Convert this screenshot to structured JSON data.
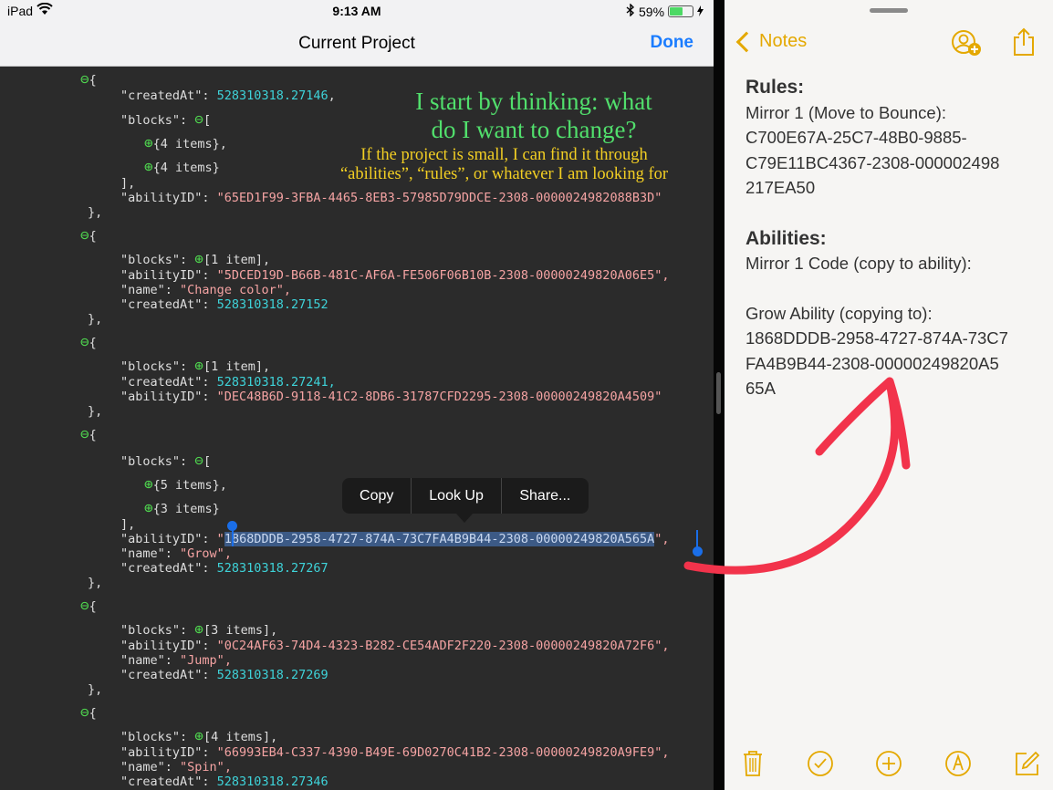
{
  "status": {
    "carrier": "iPad",
    "time": "9:13 AM",
    "battery": "59%",
    "battery_fraction": 0.59
  },
  "nav": {
    "title": "Current Project",
    "done_label": "Done"
  },
  "code": {
    "l1_created_key": "\"createdAt\"",
    "l1_created_val": "528310318.27146",
    "l1_blocks_key": "\"blocks\"",
    "l1_items_a": "{4 items},",
    "l1_items_b": "{4 items}",
    "l1_ability_key": "\"abilityID\"",
    "l1_ability_val": "\"65ED1F99-3FBA-4465-8EB3-57985D79DDCE-2308-0000024982088B3D\"",
    "l2_blocks_key": "\"blocks\"",
    "l2_items": "[1 item],",
    "l2_ability_key": "\"abilityID\"",
    "l2_ability_val": "\"5DCED19D-B66B-481C-AF6A-FE506F06B10B-2308-00000249820A06E5\",",
    "l2_name_key": "\"name\"",
    "l2_name_val": "\"Change color\",",
    "l2_created_key": "\"createdAt\"",
    "l2_created_val": "528310318.27152",
    "l3_blocks_key": "\"blocks\"",
    "l3_items": "[1 item],",
    "l3_created_key": "\"createdAt\"",
    "l3_created_val": "528310318.27241,",
    "l3_ability_key": "\"abilityID\"",
    "l3_ability_val": "\"DEC48B6D-9118-41C2-8DB6-31787CFD2295-2308-00000249820A4509\"",
    "l4_blocks_key": "\"blocks\"",
    "l4_items_a": "{5 items},",
    "l4_items_b": "{3 items}",
    "l4_ability_key": "\"abilityID\"",
    "l4_ability_sel": "1868DDDB-2958-4727-874A-73C7FA4B9B44-2308-00000249820A565A",
    "l4_name_key": "\"name\"",
    "l4_name_val": "\"Grow\",",
    "l4_created_key": "\"createdAt\"",
    "l4_created_val": "528310318.27267",
    "l5_blocks_key": "\"blocks\"",
    "l5_items": "[3 items],",
    "l5_ability_key": "\"abilityID\"",
    "l5_ability_val": "\"0C24AF63-74D4-4323-B282-CE54ADF2F220-2308-00000249820A72F6\",",
    "l5_name_key": "\"name\"",
    "l5_name_val": "\"Jump\",",
    "l5_created_key": "\"createdAt\"",
    "l5_created_val": "528310318.27269",
    "l6_blocks_key": "\"blocks\"",
    "l6_items": "[4 items],",
    "l6_ability_key": "\"abilityID\"",
    "l6_ability_val": "\"66993EB4-C337-4390-B49E-69D0270C41B2-2308-00000249820A9FE9\",",
    "l6_name_key": "\"name\"",
    "l6_name_val": "\"Spin\",",
    "l6_created_key": "\"createdAt\"",
    "l6_created_val": "528310318.27346"
  },
  "annotation": {
    "line1": "I start by thinking: what",
    "line2": "do I want to change?",
    "line3": "If the project is small, I can find it through",
    "line4": "“abilities”, “rules”, or whatever I am looking for"
  },
  "menu": {
    "copy": "Copy",
    "lookup": "Look Up",
    "share": "Share..."
  },
  "notes": {
    "back_label": "Notes",
    "rules_heading": "Rules:",
    "rules_line1": "Mirror 1 (Move to Bounce):",
    "rules_line2": "C700E67A-25C7-48B0-9885-",
    "rules_line3": "C79E11BC4367-2308-000002498",
    "rules_line4": "217EA50",
    "abilities_heading": "Abilities:",
    "abilities_line1": "Mirror 1 Code (copy to ability):",
    "grow_line1": "Grow Ability (copying to):",
    "grow_line2": "1868DDDB-2958-4727-874A-73C7",
    "grow_line3": "FA4B9B44-2308-00000249820A5",
    "grow_line4": "65A"
  },
  "colors": {
    "accent_blue": "#1a7cff",
    "notes_yellow": "#e4a800",
    "arrow_red": "#f2334b",
    "annotation_green": "#51df6c",
    "annotation_yellow": "#f3cf23"
  }
}
